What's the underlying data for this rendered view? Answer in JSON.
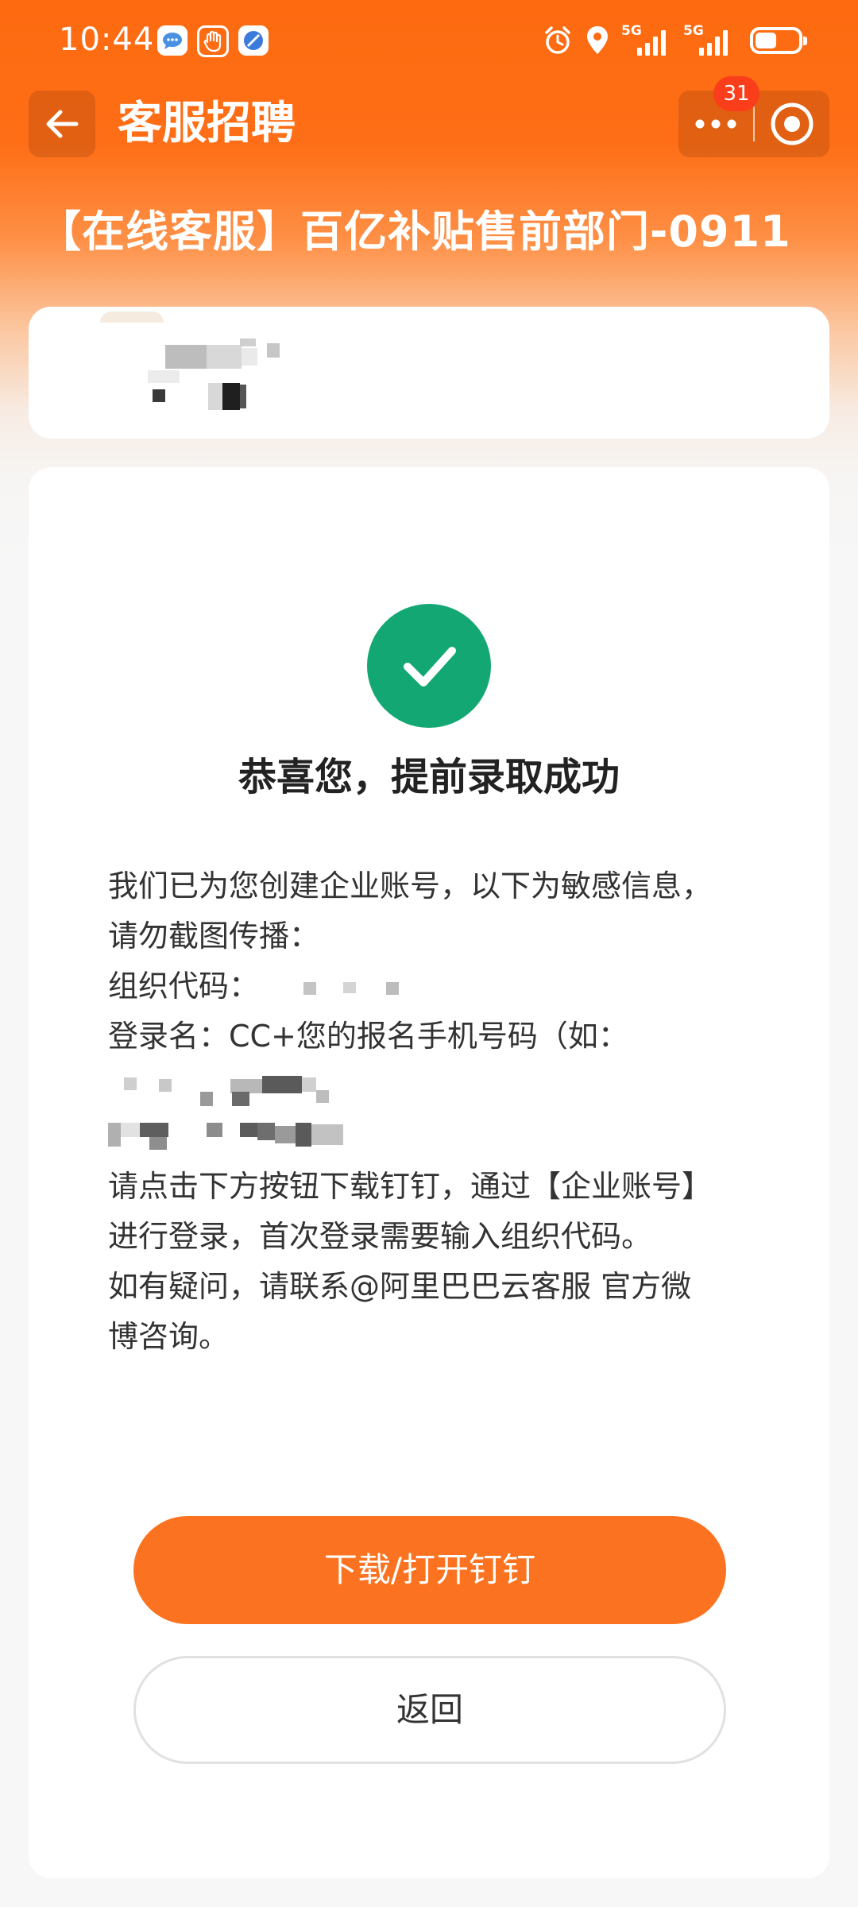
{
  "status_bar": {
    "time": "10:44",
    "network_1": "5G",
    "network_2": "5G",
    "icons": [
      "message-icon",
      "hand-icon",
      "browser-icon",
      "alarm-icon",
      "location-icon",
      "signal-icon",
      "battery-icon"
    ]
  },
  "header": {
    "title": "客服招聘",
    "badge": "31"
  },
  "job": {
    "title": "【在线客服】百亿补贴售前部门-0911"
  },
  "result": {
    "title": "恭喜您，提前录取成功",
    "lines": [
      "我们已为您创建企业账号，以下为敏感信息，",
      "请勿截图传播：",
      "组织代码：",
      "登录名：CC+您的报名手机号码（如：",
      "请点击下方按钮下载钉钉，通过【企业账号】",
      "进行登录，首次登录需要输入组织代码。",
      "如有疑问，请联系@阿里巴巴云客服 官方微",
      "博咨询。"
    ]
  },
  "actions": {
    "primary": "下载/打开钉钉",
    "secondary": "返回"
  },
  "colors": {
    "accent": "#fb7320",
    "success": "#13a873",
    "badge": "#fa3d1a"
  }
}
